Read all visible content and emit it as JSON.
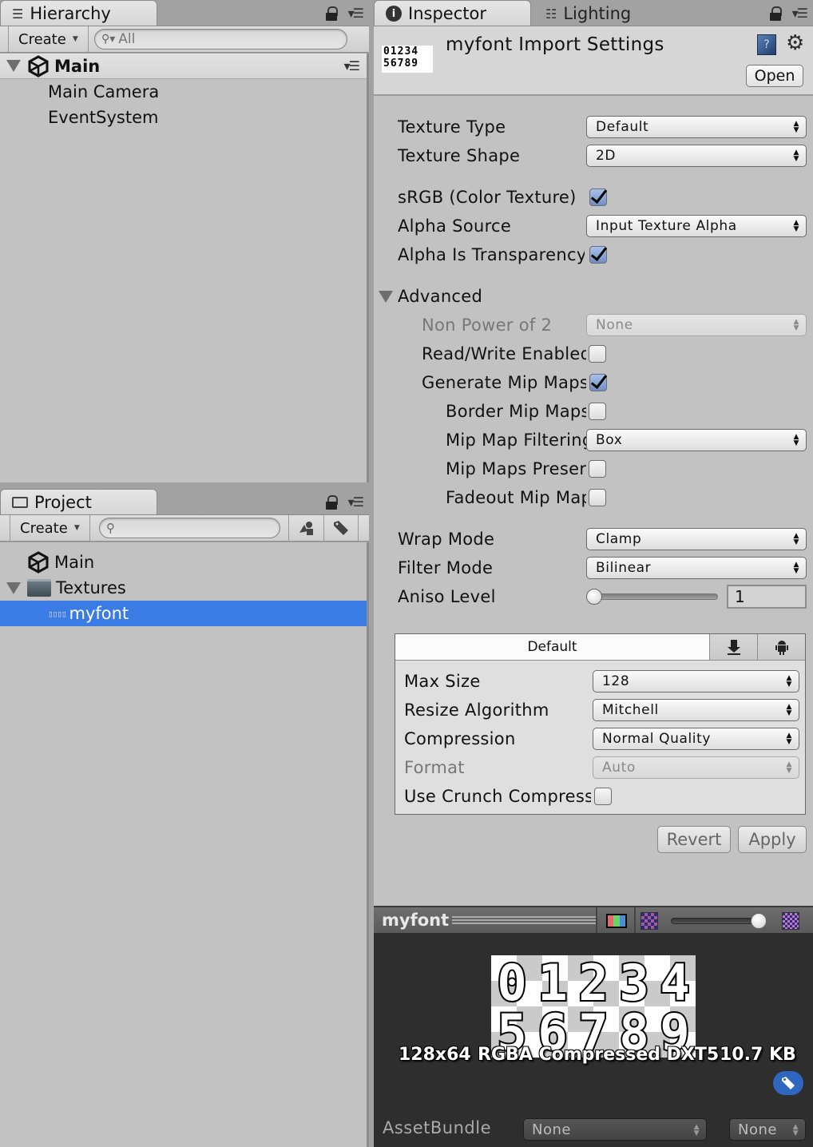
{
  "hierarchy": {
    "tab_label": "Hierarchy",
    "create_label": "Create",
    "search_placeholder": "All",
    "scene": "Main",
    "items": [
      "Main Camera",
      "EventSystem"
    ]
  },
  "project": {
    "tab_label": "Project",
    "create_label": "Create",
    "search_placeholder": "",
    "items": [
      {
        "label": "Main",
        "icon": "unity-scene-icon"
      },
      {
        "label": "Textures",
        "icon": "folder-icon",
        "expanded": true
      },
      {
        "label": "myfont",
        "icon": "texture-icon",
        "selected": true
      }
    ]
  },
  "inspector": {
    "tabs": [
      {
        "label": "Inspector",
        "icon": "info-icon",
        "active": true
      },
      {
        "label": "Lighting",
        "icon": "sliders-icon",
        "active": false
      }
    ],
    "title": "myfont Import Settings",
    "open_label": "Open",
    "thumbnail_rows": [
      "01234",
      "56789"
    ],
    "props": {
      "texture_type": {
        "label": "Texture Type",
        "value": "Default"
      },
      "texture_shape": {
        "label": "Texture Shape",
        "value": "2D"
      },
      "srgb": {
        "label": "sRGB (Color Texture)",
        "checked": true
      },
      "alpha_source": {
        "label": "Alpha Source",
        "value": "Input Texture Alpha"
      },
      "alpha_transparency": {
        "label": "Alpha Is Transparency",
        "checked": true
      },
      "advanced": {
        "label": "Advanced",
        "expanded": true
      },
      "npot": {
        "label": "Non Power of 2",
        "value": "None",
        "disabled": true
      },
      "read_write": {
        "label": "Read/Write Enabled",
        "checked": false
      },
      "gen_mips": {
        "label": "Generate Mip Maps",
        "checked": true
      },
      "border_mips": {
        "label": "Border Mip Maps",
        "checked": false
      },
      "mip_filter": {
        "label": "Mip Map Filtering",
        "value": "Box"
      },
      "mip_preserve": {
        "label": "Mip Maps Preserve Coverage",
        "checked": false
      },
      "fadeout": {
        "label": "Fadeout Mip Maps",
        "checked": false
      },
      "wrap_mode": {
        "label": "Wrap Mode",
        "value": "Clamp"
      },
      "filter_mode": {
        "label": "Filter Mode",
        "value": "Bilinear"
      },
      "aniso": {
        "label": "Aniso Level",
        "value": "1",
        "slider_fraction": 0.0
      }
    },
    "platform": {
      "tabs": [
        {
          "label": "Default",
          "active": true
        },
        {
          "label": "",
          "icon": "download-icon"
        },
        {
          "label": "",
          "icon": "android-icon"
        }
      ],
      "max_size": {
        "label": "Max Size",
        "value": "128"
      },
      "resize": {
        "label": "Resize Algorithm",
        "value": "Mitchell"
      },
      "compression": {
        "label": "Compression",
        "value": "Normal Quality"
      },
      "format": {
        "label": "Format",
        "value": "Auto",
        "disabled": true
      },
      "crunch": {
        "label": "Use Crunch Compression",
        "checked": false
      }
    },
    "revert_label": "Revert",
    "apply_label": "Apply"
  },
  "preview": {
    "title": "myfont",
    "dimensions": "128x64",
    "format": "RGBA Compressed DXT5",
    "size": "10.7 KB",
    "mip_slider_fraction": 1.0,
    "assetbundle_label": "AssetBundle",
    "assetbundle_name": "None",
    "assetbundle_variant": "None"
  },
  "colors": {
    "selection": "#3b7be6",
    "panel_bg": "#c2c2c2",
    "preview_bg": "#2e2e2e",
    "checkbox_checked": "#7f9bd0"
  }
}
